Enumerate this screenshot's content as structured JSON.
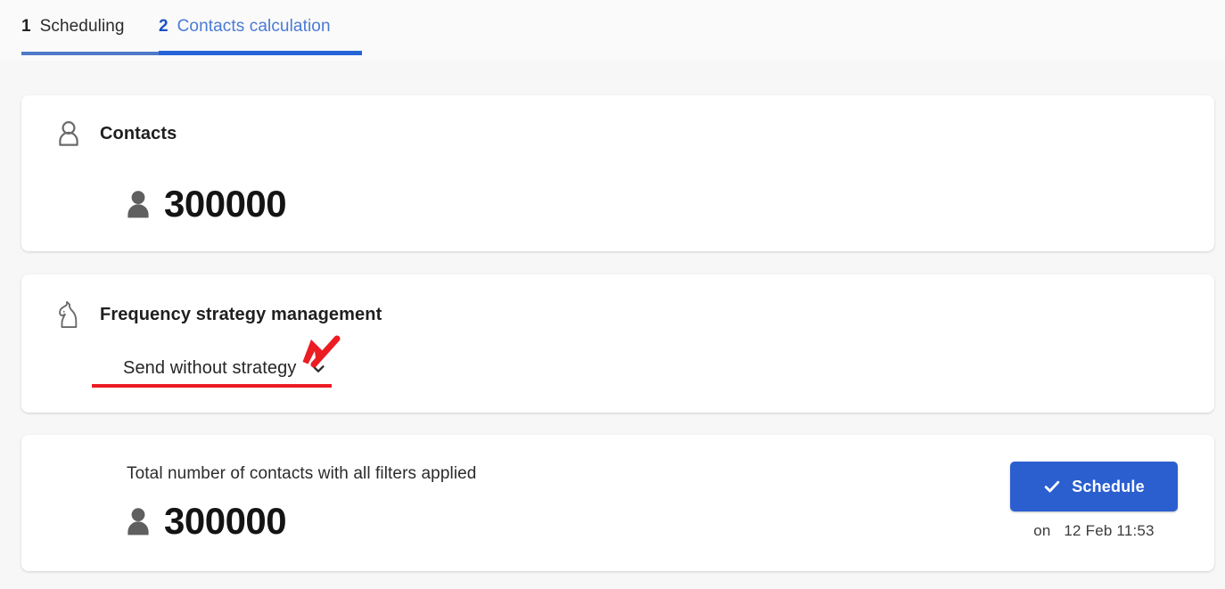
{
  "tabs": [
    {
      "number": "1",
      "label": "Scheduling",
      "active": false
    },
    {
      "number": "2",
      "label": "Contacts calculation",
      "active": true
    }
  ],
  "cards": {
    "contacts": {
      "icon": "person-outline-icon",
      "title": "Contacts",
      "value_icon": "person-filled-icon",
      "value": "300000"
    },
    "frequency": {
      "icon": "chess-knight-icon",
      "title": "Frequency strategy management",
      "dropdown": {
        "name": "frequency-strategy-select",
        "selected": "Send without strategy",
        "chevron": "chevron-down-icon"
      }
    },
    "total": {
      "label": "Total number of contacts with all filters applied",
      "value_icon": "person-filled-icon",
      "value": "300000",
      "schedule_button": {
        "icon": "check-icon",
        "label": "Schedule"
      },
      "schedule_time_prefix": "on",
      "schedule_time": "12 Feb 11:53"
    }
  },
  "annotations": {
    "arrow": "red-arrow-annotation",
    "underline": "red-underline-annotation",
    "color": "#ec1c23"
  },
  "colors": {
    "accent_blue": "#2b5fd0",
    "tab_active_number": "#1b52c4",
    "tab_active_label": "#4a7ad6",
    "page_background": "#f7f7f7",
    "card_background": "#ffffff"
  }
}
